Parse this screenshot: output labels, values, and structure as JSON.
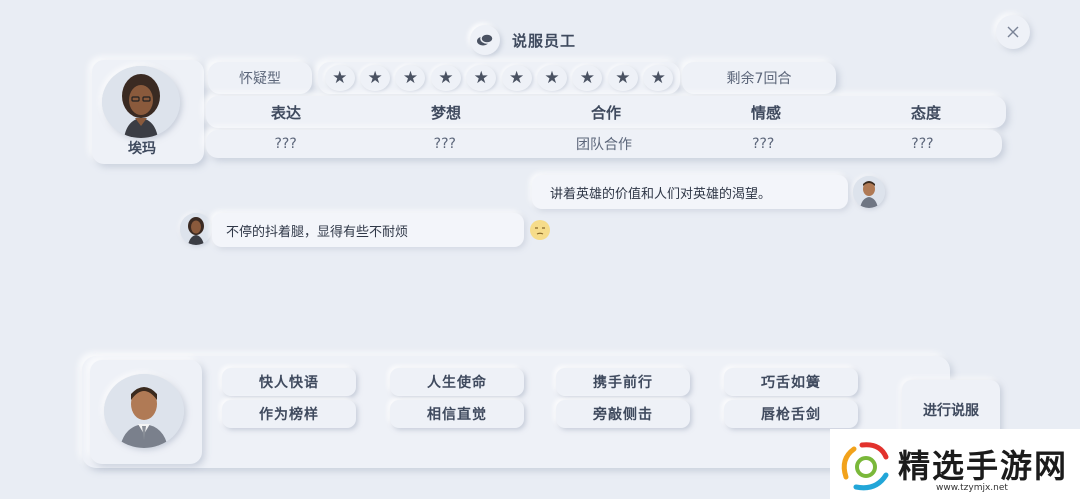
{
  "dialog": {
    "title": "说服员工"
  },
  "npc": {
    "name": "埃玛",
    "trait": "怀疑型",
    "stars_total": 10,
    "rounds_left": "剩余7回合"
  },
  "attributes": {
    "headers": [
      "表达",
      "梦想",
      "合作",
      "情感",
      "态度"
    ],
    "values": [
      "???",
      "???",
      "团队合作",
      "???",
      "???"
    ]
  },
  "chat": {
    "player_message": "讲着英雄的价值和人们对英雄的渴望。",
    "npc_message": "不停的抖着腿，显得有些不耐烦",
    "npc_mood_icon": "unamused-face-icon"
  },
  "actions": [
    {
      "label": "快人快语"
    },
    {
      "label": "人生使命"
    },
    {
      "label": "携手前行"
    },
    {
      "label": "巧舌如簧"
    },
    {
      "label": "作为榜样"
    },
    {
      "label": "相信直觉"
    },
    {
      "label": "旁敲侧击"
    },
    {
      "label": "唇枪舌剑"
    }
  ],
  "go_button": {
    "label": "进行说服"
  },
  "watermark": {
    "title": "精选手游网",
    "url": "www.tzymjx.net"
  },
  "colors": {
    "background": "#e9edf4",
    "panel": "#eef1f7",
    "text": "#3f4a5e"
  }
}
